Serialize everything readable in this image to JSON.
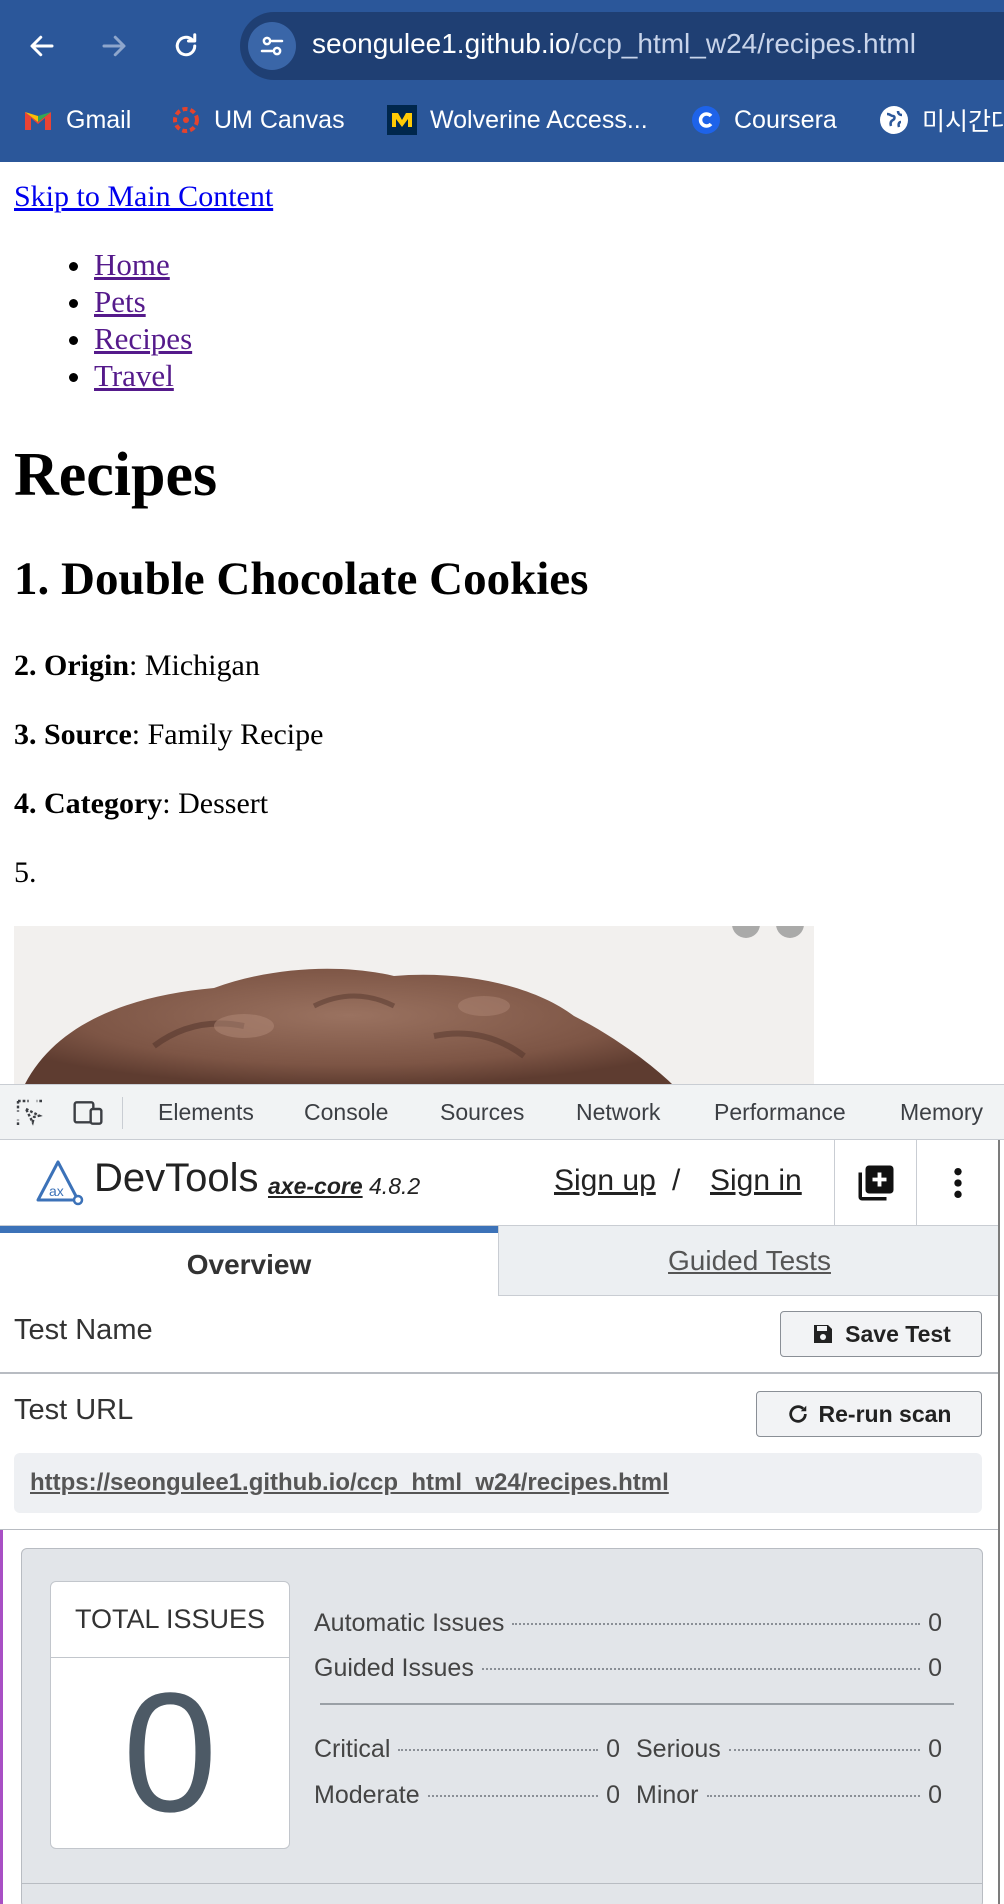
{
  "browser": {
    "url_host": "seongulee1.github.io",
    "url_path": "/ccp_html_w24/recipes.html",
    "bookmarks": [
      "Gmail",
      "UM Canvas",
      "Wolverine Access...",
      "Coursera",
      "미시간대"
    ]
  },
  "page": {
    "skip_link": "Skip to Main Content",
    "nav": [
      "Home",
      "Pets",
      "Recipes",
      "Travel"
    ],
    "title": "Recipes",
    "recipe_title": "1. Double Chocolate Cookies",
    "facts": [
      {
        "num": "2. ",
        "label": "Origin",
        "value": ": Michigan"
      },
      {
        "num": "3. ",
        "label": "Source",
        "value": ": Family Recipe"
      },
      {
        "num": "4. ",
        "label": "Category",
        "value": ": Dessert"
      }
    ],
    "item5": "5."
  },
  "devtools": {
    "tabs": [
      "Elements",
      "Console",
      "Sources",
      "Network",
      "Performance",
      "Memory"
    ]
  },
  "axe": {
    "brand": "DevTools",
    "core_name": "axe-core",
    "core_version": "4.8.2",
    "sign_up": "Sign up",
    "slash": "/",
    "sign_in": "Sign in",
    "tab_overview": "Overview",
    "tab_guided": "Guided Tests",
    "test_name_label": "Test Name",
    "save_test": "Save Test",
    "test_url_label": "Test URL",
    "rerun": "Re-run scan",
    "test_url": "https://seongulee1.github.io/ccp_html_w24/recipes.html",
    "total_label": "TOTAL ISSUES",
    "total": "0",
    "automatic_label": "Automatic Issues",
    "automatic": "0",
    "guided_label": "Guided Issues",
    "guided": "0",
    "critical_label": "Critical",
    "critical": "0",
    "serious_label": "Serious",
    "serious": "0",
    "moderate_label": "Moderate",
    "moderate": "0",
    "minor_label": "Minor",
    "minor": "0"
  }
}
